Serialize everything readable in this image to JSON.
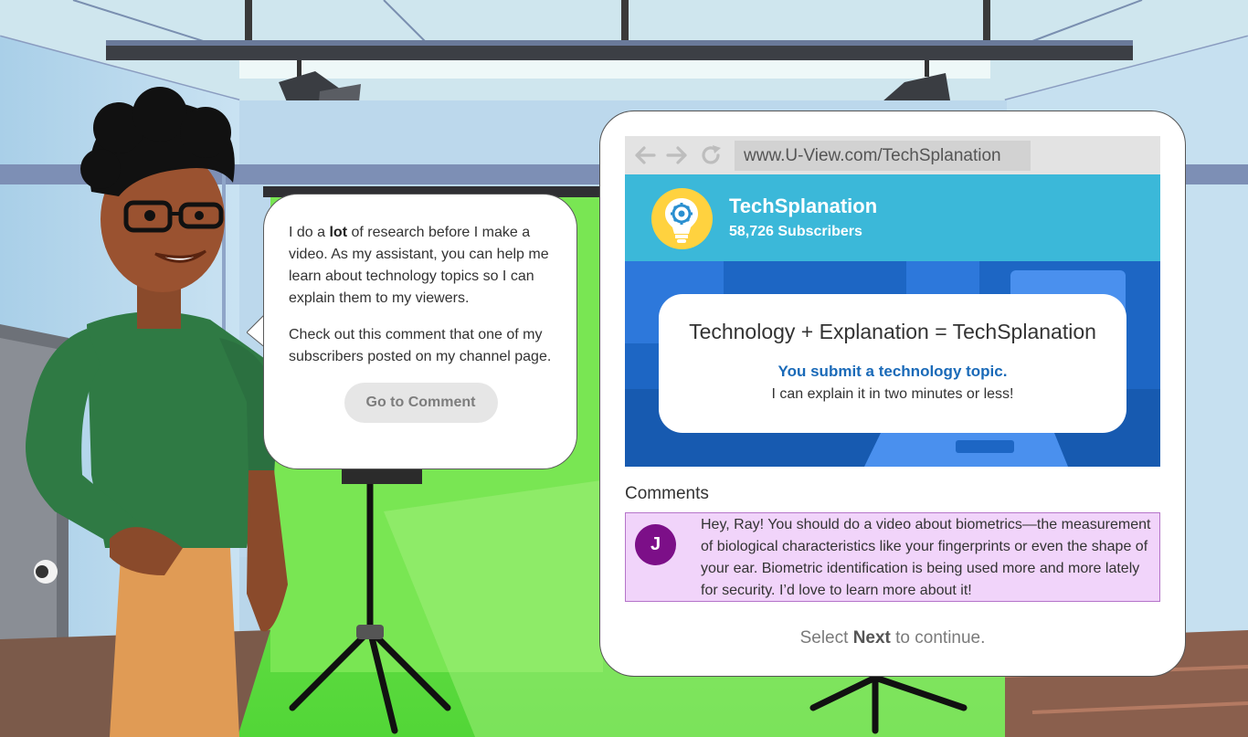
{
  "speech": {
    "p1_before": "I do a ",
    "p1_bold": "lot",
    "p1_after": " of research before I make a video. As my assistant, you can help me learn about technology topics so I can explain them to my viewers.",
    "p2": "Check out this comment that one of my subscribers posted on my channel page.",
    "button_label": "Go to Comment"
  },
  "browser": {
    "url": "www.U-View.com/TechSplanation"
  },
  "channel": {
    "name": "TechSplanation",
    "subscribers": "58,726 Subscribers"
  },
  "banner": {
    "title": "Technology + Explanation = TechSplanation",
    "link": "You submit a technology topic.",
    "subtitle": "I can explain it in two minutes or less!"
  },
  "comments": {
    "heading": "Comments",
    "items": [
      {
        "initial": "J",
        "text": "Hey, Ray! You should do a video about biometrics—the measurement of biological characteristics like your fingerprints or even the shape of your ear. Biometric identification is being used more and more lately for security. I’d love to learn more about it!"
      }
    ]
  },
  "hint": {
    "before": "Select ",
    "bold": "Next",
    "after": " to continue."
  },
  "colors": {
    "header_blue": "#3bb8d9",
    "banner_blue": "#1d66c4",
    "link_blue": "#1a6ab8",
    "comment_bg": "#f1d4fa",
    "avatar_purple": "#7c0f88",
    "greenscreen": "#6fe34a"
  }
}
